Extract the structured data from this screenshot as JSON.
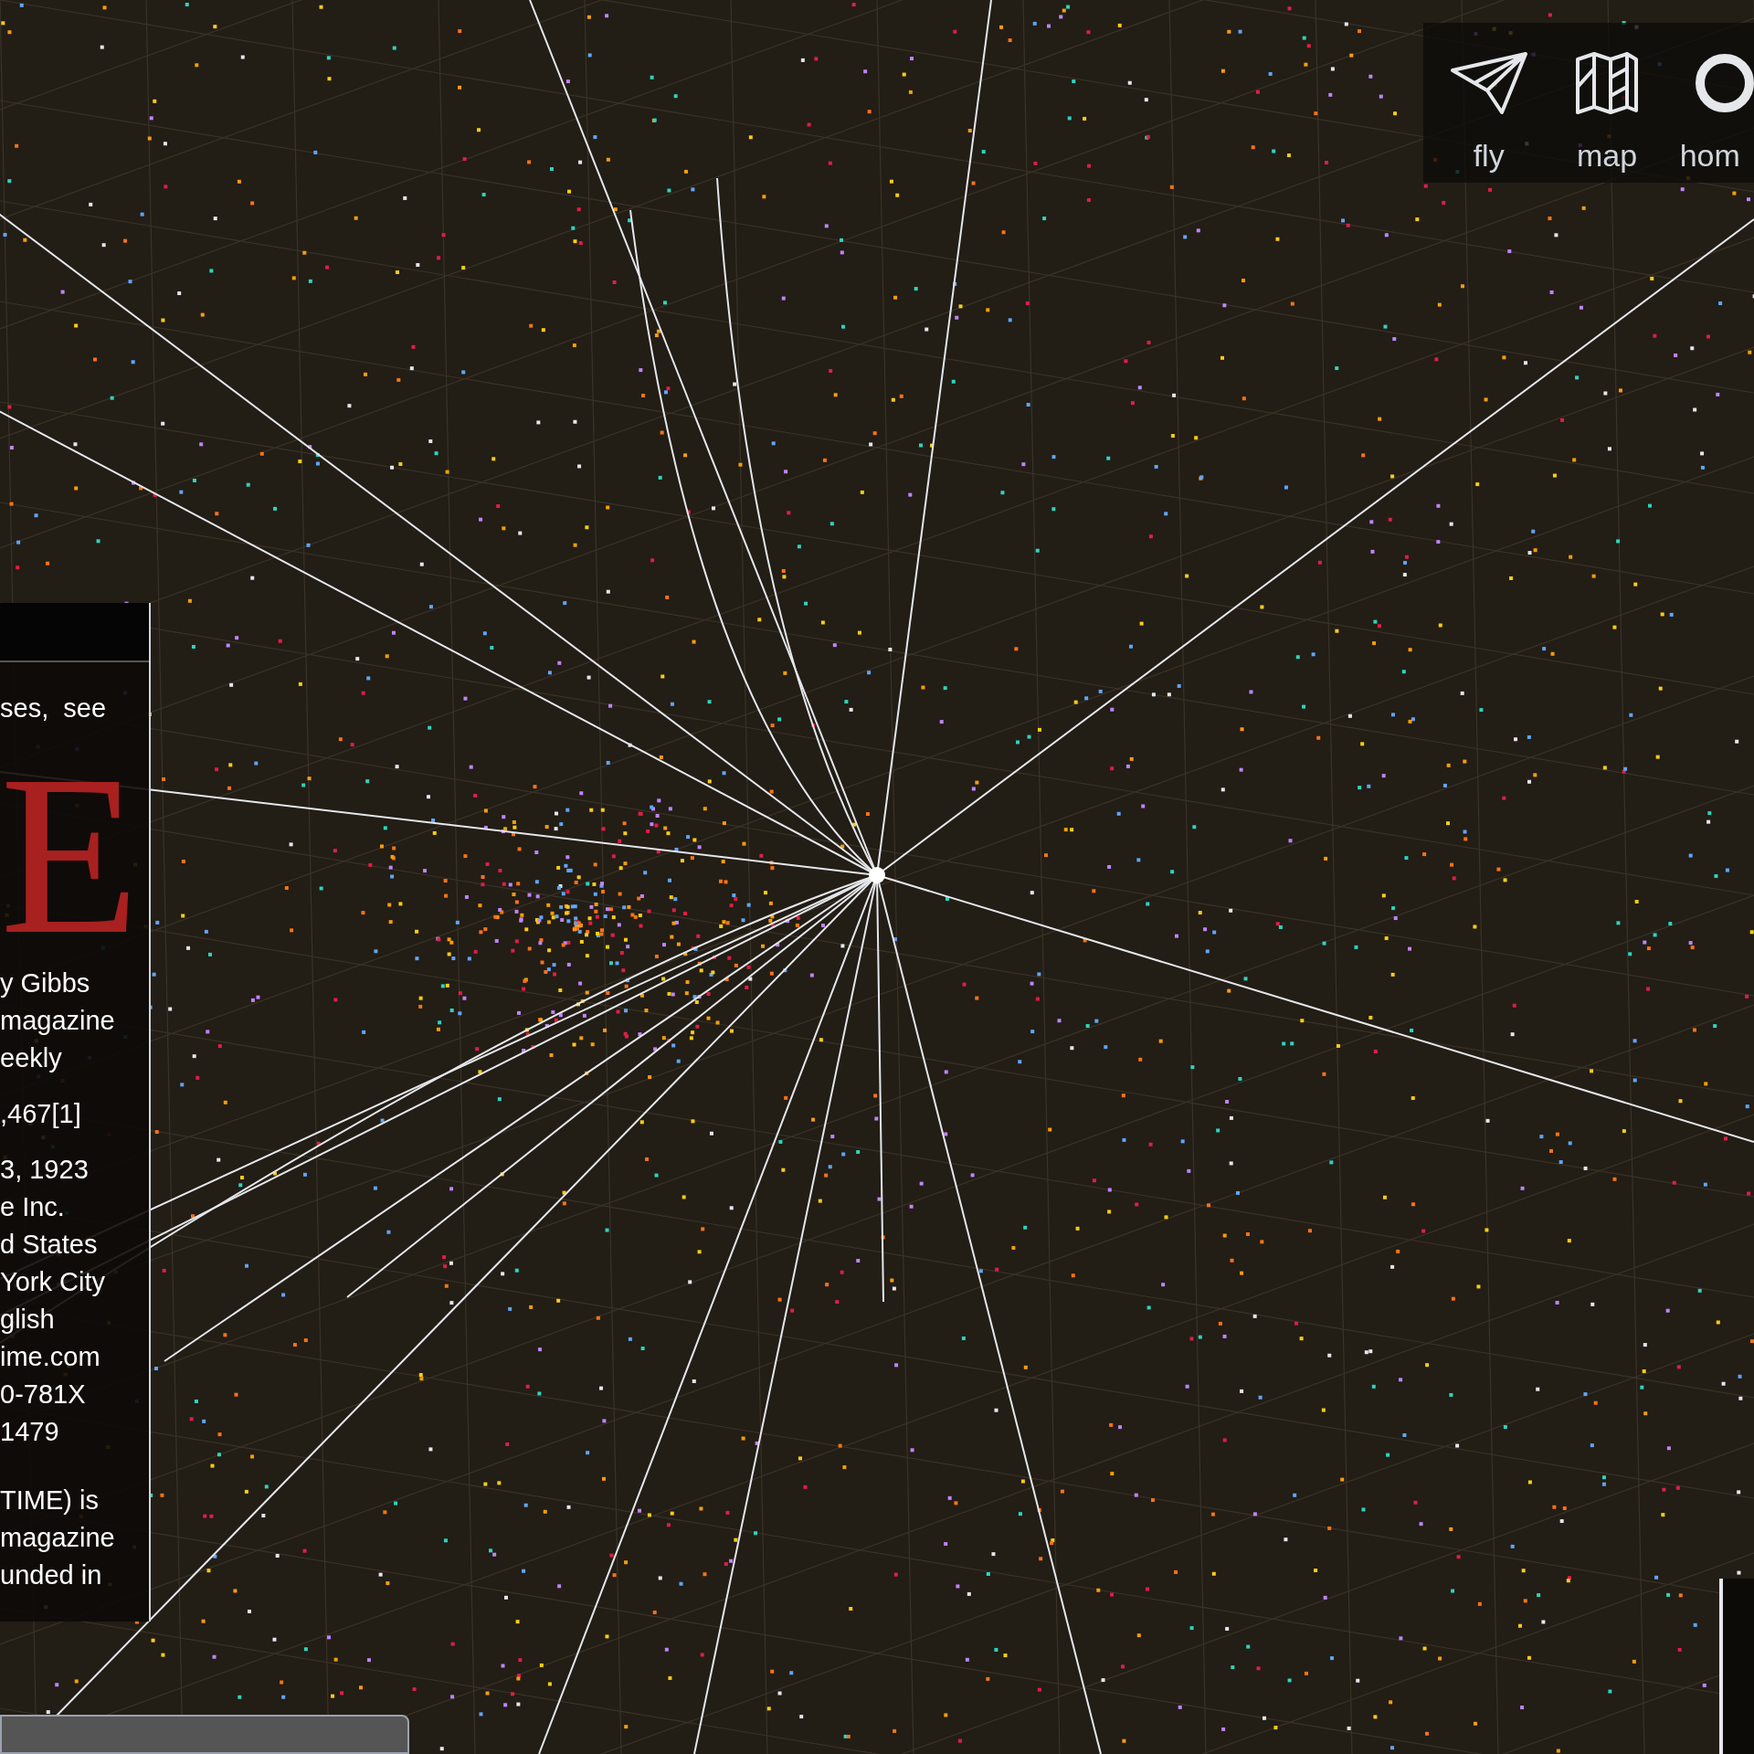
{
  "toolbar": {
    "buttons": [
      {
        "kind": "plane",
        "label": "fly"
      },
      {
        "kind": "map",
        "label": "map"
      },
      {
        "kind": "ring",
        "label": "hom"
      }
    ]
  },
  "info_panel": {
    "note": "ses,  see",
    "logo": "E",
    "fields": [
      "y Gibbs",
      "magazine",
      "eekly",
      ",467[1]",
      "3, 1923",
      "e Inc.",
      "d States",
      "York City",
      "glish",
      "ime.com",
      "0-781X",
      "1479"
    ],
    "description": [
      "TIME) is",
      "magazine",
      "unded in"
    ]
  }
}
